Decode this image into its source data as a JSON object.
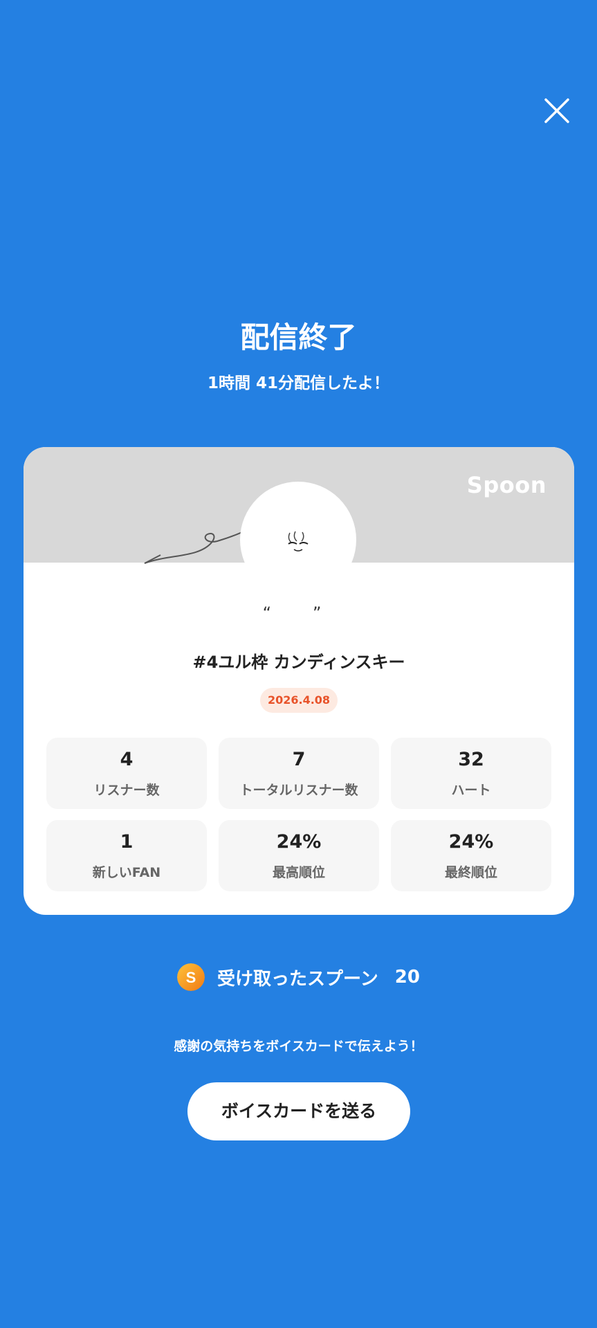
{
  "header": {
    "title": "配信終了",
    "subtitle": "1時間 41分配信したよ！"
  },
  "card": {
    "brand": "Spoon",
    "stream_title": "#4ユル枠 カンディンスキー",
    "date": "2026.4.08",
    "stats": [
      {
        "value": "4",
        "label": "リスナー数"
      },
      {
        "value": "7",
        "label": "トータルリスナー数"
      },
      {
        "value": "32",
        "label": "ハート"
      },
      {
        "value": "1",
        "label": "新しいFAN"
      },
      {
        "value": "24%",
        "label": "最高順位"
      },
      {
        "value": "24%",
        "label": "最終順位"
      }
    ]
  },
  "spoons": {
    "label": "受け取ったスプーン",
    "count": "20",
    "coin_letter": "S"
  },
  "thanks_text": "感謝の気持ちをボイスカードで伝えよう！",
  "voice_card_button": "ボイスカードを送る",
  "colors": {
    "background": "#2480E2",
    "date_text": "#E8532A",
    "date_badge": "#FDEAE1",
    "coin": "#F39A1E"
  },
  "icons": {
    "close": "close-icon",
    "coin": "spoon-coin-icon"
  }
}
